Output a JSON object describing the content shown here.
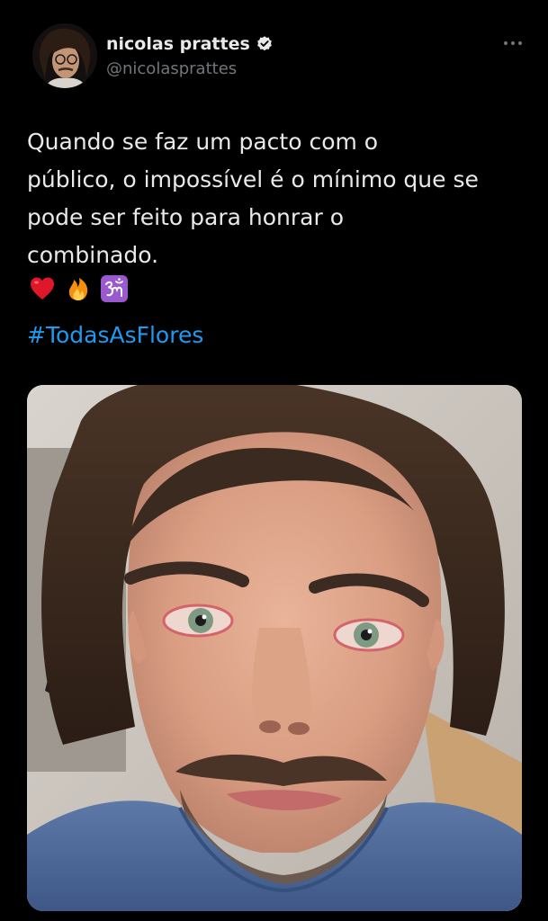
{
  "user": {
    "display_name": "nicolas prattes",
    "handle": "@nicolasprattes",
    "verified": true
  },
  "tweet": {
    "text_lines": [
      "Quando se faz um pacto com o",
      "público, o impossível é o mínimo que se",
      "pode ser feito para honrar o",
      "combinado."
    ],
    "emojis": [
      "❤️",
      "🔥",
      "🕉️"
    ],
    "hashtag": "#TodasAsFlores"
  },
  "icons": {
    "verified": "verified-badge-icon",
    "more": "more-options-icon"
  },
  "colors": {
    "background": "#000000",
    "text": "#e7e9ea",
    "secondary": "#71767b",
    "link": "#1d9bf0"
  }
}
